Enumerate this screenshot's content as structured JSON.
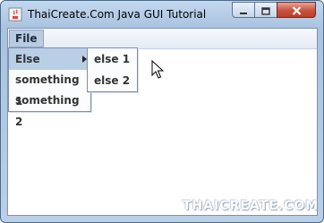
{
  "window": {
    "title": "ThaiCreate.Com Java GUI Tutorial"
  },
  "menubar": {
    "file_label": "File"
  },
  "file_menu": {
    "items": [
      {
        "label": "Else",
        "has_submenu": true,
        "selected": true
      },
      {
        "label": "something 1"
      },
      {
        "label": "something 2"
      }
    ]
  },
  "submenu": {
    "items": [
      {
        "label": "else 1"
      },
      {
        "label": "else 2"
      }
    ]
  },
  "watermark": "THAICREATE.COM",
  "icons": {
    "app": "java-cup-icon",
    "minimize": "minimize-icon",
    "maximize": "maximize-icon",
    "close": "close-icon",
    "submenu_arrow": "chevron-right-icon",
    "cursor": "mouse-pointer-icon"
  },
  "colors": {
    "title_bar": "#b9cfe8",
    "menu_selected": "#b8cfe5",
    "close_button": "#c9503d"
  }
}
